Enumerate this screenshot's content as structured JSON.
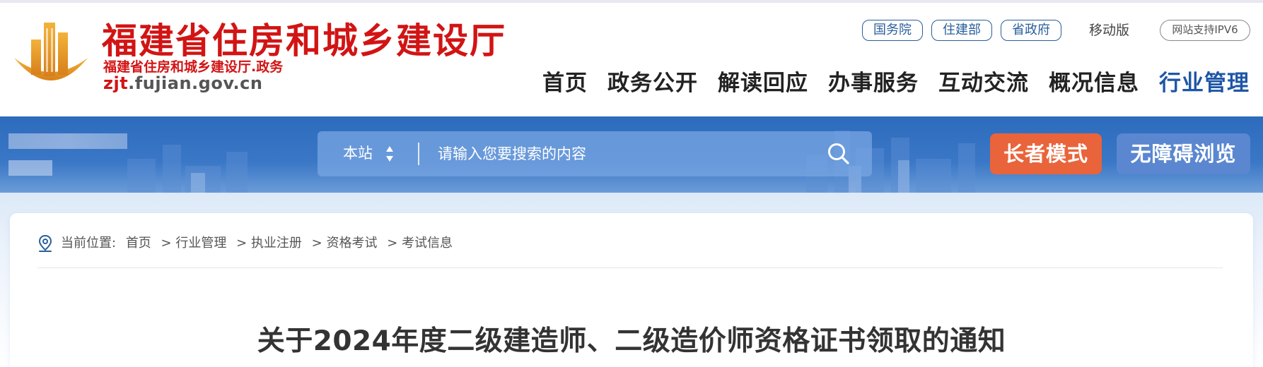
{
  "header": {
    "site_title": "福建省住房和城乡建设厅",
    "site_subtitle": "福建省住房和城乡建设厅.政务",
    "url_prefix": "zjt",
    "url_suffix": ".fujian.gov.cn",
    "top_links": [
      "国务院",
      "住建部",
      "省政府"
    ],
    "mobile_label": "移动版",
    "ipv6_label": "网站支持IPV6",
    "nav": [
      "首页",
      "政务公开",
      "解读回应",
      "办事服务",
      "互动交流",
      "概况信息",
      "行业管理"
    ],
    "active_nav": "行业管理"
  },
  "search": {
    "scope": "本站",
    "placeholder": "请输入您要搜索的内容"
  },
  "buttons": {
    "elder_mode": "长者模式",
    "accessible": "无障碍浏览"
  },
  "breadcrumb": {
    "prefix": "当前位置:",
    "items": [
      "首页",
      "行业管理",
      "执业注册",
      "资格考试",
      "考试信息"
    ],
    "separator": ">"
  },
  "article": {
    "title": "关于2024年度二级建造师、二级造价师资格证书领取的通知"
  },
  "colors": {
    "brand_red": "#d21414",
    "nav_active": "#1e56a6",
    "banner_blue": "#3a77c6",
    "elder_orange": "#e9643a",
    "accessible_blue": "#5a87d0"
  },
  "icons": [
    "building-logo-icon",
    "sort-arrows-icon",
    "search-icon",
    "location-pin-icon"
  ]
}
